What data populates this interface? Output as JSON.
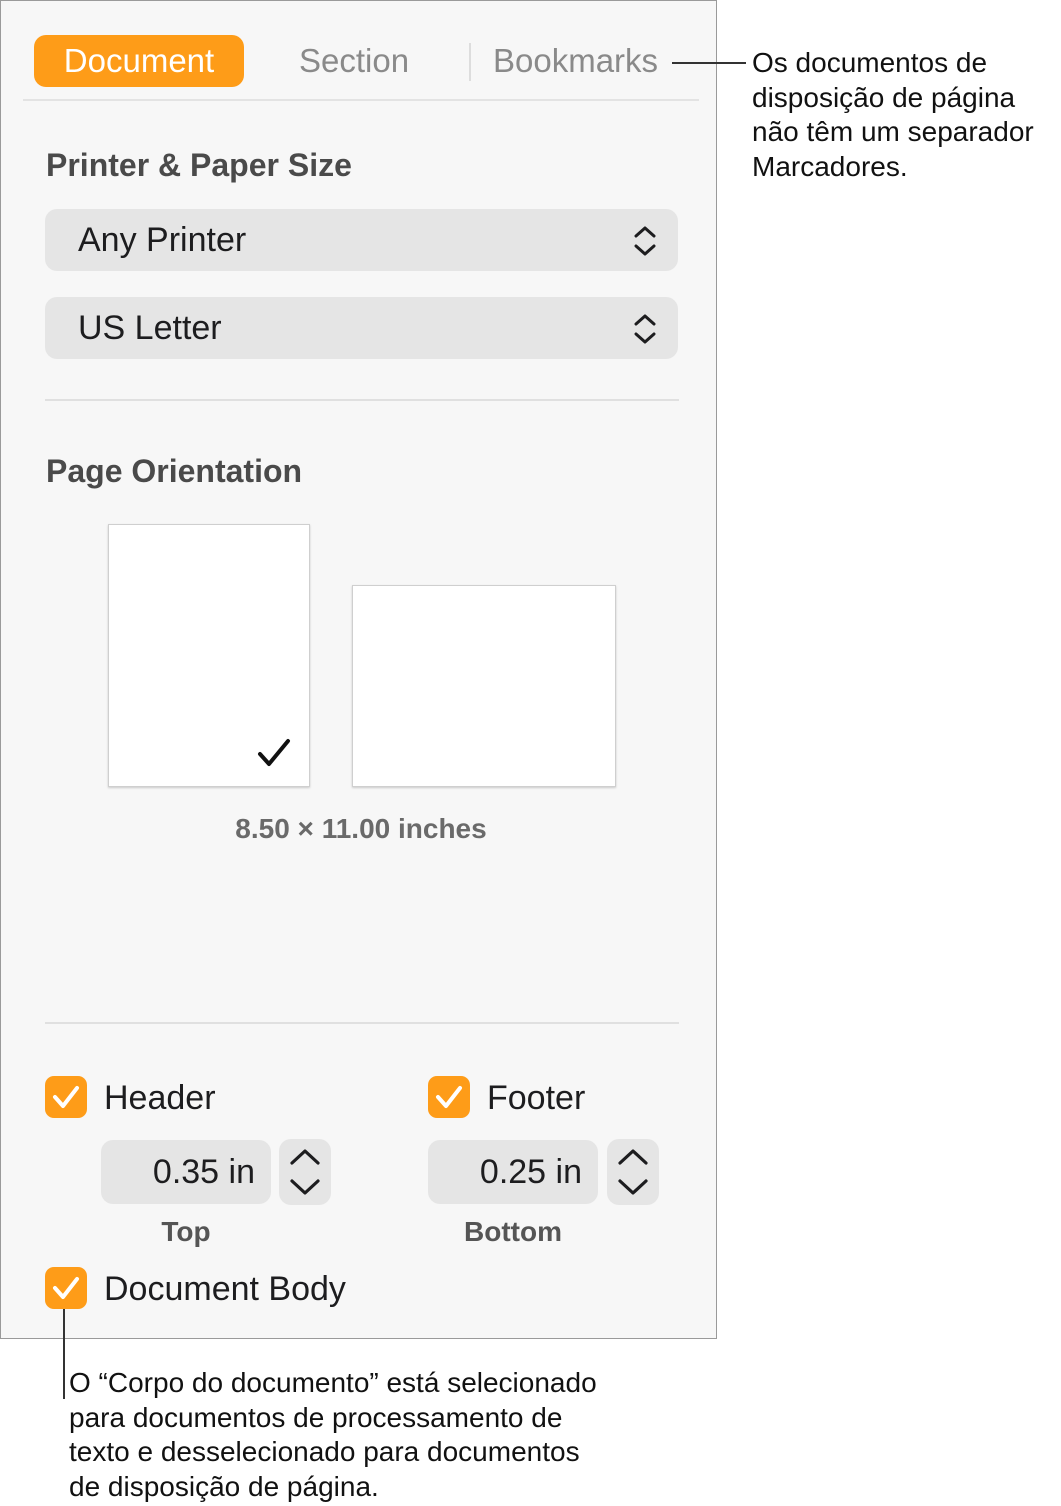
{
  "tabs": {
    "document": "Document",
    "section": "Section",
    "bookmarks": "Bookmarks"
  },
  "printer_paper": {
    "heading": "Printer & Paper Size",
    "printer": "Any Printer",
    "paper": "US Letter"
  },
  "orientation": {
    "heading": "Page Orientation",
    "selected": "portrait",
    "dimensions": "8.50 × 11.00 inches"
  },
  "header": {
    "label": "Header",
    "checked": true,
    "value": "0.35 in",
    "caption": "Top"
  },
  "footer": {
    "label": "Footer",
    "checked": true,
    "value": "0.25 in",
    "caption": "Bottom"
  },
  "body": {
    "label": "Document Body",
    "checked": true
  },
  "callouts": {
    "bookmarks": [
      "Os documentos de",
      "disposição de página",
      "não têm um separador",
      "Marcadores."
    ],
    "body": [
      "O “Corpo do documento” está selecionado",
      "para documentos de processamento de",
      "texto e desselecionado para documentos",
      "de disposição de página."
    ]
  },
  "colors": {
    "accent": "#fe9c18",
    "panel": "#f7f7f7",
    "control": "#e5e5e5"
  }
}
